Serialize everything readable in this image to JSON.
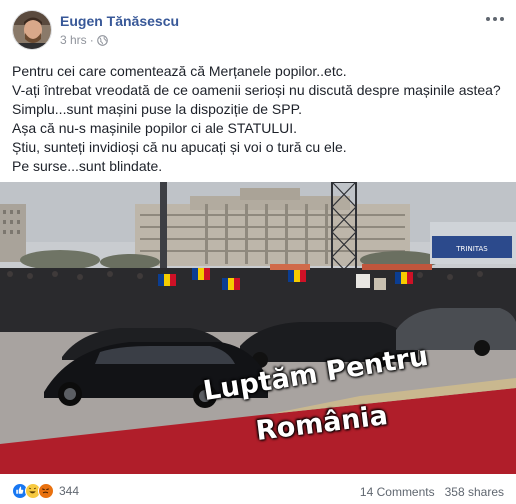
{
  "post": {
    "author": "Eugen Tănăsescu",
    "time": "3 hrs",
    "lines": [
      "Pentru cei care comentează că Merțanele popilor..etc.",
      "V-ați întrebat vreodată de ce oamenii serioși nu discută despre mașinile astea?",
      "Simplu...sunt mașini puse la dispoziție de SPP.",
      "Așa că nu-s mașinile popilor ci ale STATULUI.",
      "Știu, sunteți invidioși că nu apucați și voi o tură cu ele.",
      "Pe surse...sunt blindate."
    ]
  },
  "photo": {
    "caption_line1": "Luptăm Pentru",
    "caption_line2": "România",
    "banner_text": "TRINITAS"
  },
  "footer": {
    "reaction_count": "344",
    "comments": "14 Comments",
    "shares": "358 shares"
  },
  "colors": {
    "author": "#385898",
    "like": "#1877f2",
    "carpet": "#b01e2a"
  },
  "icons": [
    "globe-icon",
    "more-options-icon",
    "like-reaction-icon",
    "haha-reaction-icon",
    "angry-reaction-icon"
  ]
}
